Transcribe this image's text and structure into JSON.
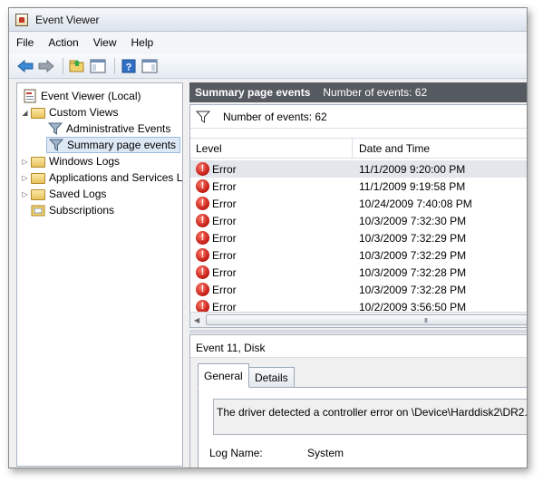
{
  "window": {
    "title": "Event Viewer"
  },
  "menu": [
    "File",
    "Action",
    "View",
    "Help"
  ],
  "toolbar": {
    "icons": [
      "back-arrow-icon",
      "forward-arrow-icon",
      "open-folder-icon",
      "show-hide-pane-icon",
      "help-icon",
      "action-pane-icon"
    ]
  },
  "tree": {
    "root": "Event Viewer (Local)",
    "custom_views": "Custom Views",
    "administrative_events": "Administrative Events",
    "summary_page_events": "Summary page events",
    "windows_logs": "Windows Logs",
    "applications_services": "Applications and Services L",
    "saved_logs": "Saved Logs",
    "subscriptions": "Subscriptions"
  },
  "panel_header": {
    "title": "Summary page events",
    "count": "Number of events: 62"
  },
  "filter_bar": {
    "text": "Number of events: 62"
  },
  "columns": {
    "level": "Level",
    "date_time": "Date and Time"
  },
  "events": [
    {
      "level": "Error",
      "datetime": "11/1/2009 9:20:00 PM"
    },
    {
      "level": "Error",
      "datetime": "11/1/2009 9:19:58 PM"
    },
    {
      "level": "Error",
      "datetime": "10/24/2009 7:40:08 PM"
    },
    {
      "level": "Error",
      "datetime": "10/3/2009 7:32:30 PM"
    },
    {
      "level": "Error",
      "datetime": "10/3/2009 7:32:29 PM"
    },
    {
      "level": "Error",
      "datetime": "10/3/2009 7:32:29 PM"
    },
    {
      "level": "Error",
      "datetime": "10/3/2009 7:32:28 PM"
    },
    {
      "level": "Error",
      "datetime": "10/3/2009 7:32:28 PM"
    },
    {
      "level": "Error",
      "datetime": "10/2/2009 3:56:50 PM"
    }
  ],
  "scroll_grip": "III",
  "detail": {
    "title": "Event 11, Disk",
    "tabs": [
      "General",
      "Details"
    ],
    "description": "The driver detected a controller error on \\Device\\Harddisk2\\DR2.",
    "log_name_label": "Log Name:",
    "log_name_value": "System"
  }
}
